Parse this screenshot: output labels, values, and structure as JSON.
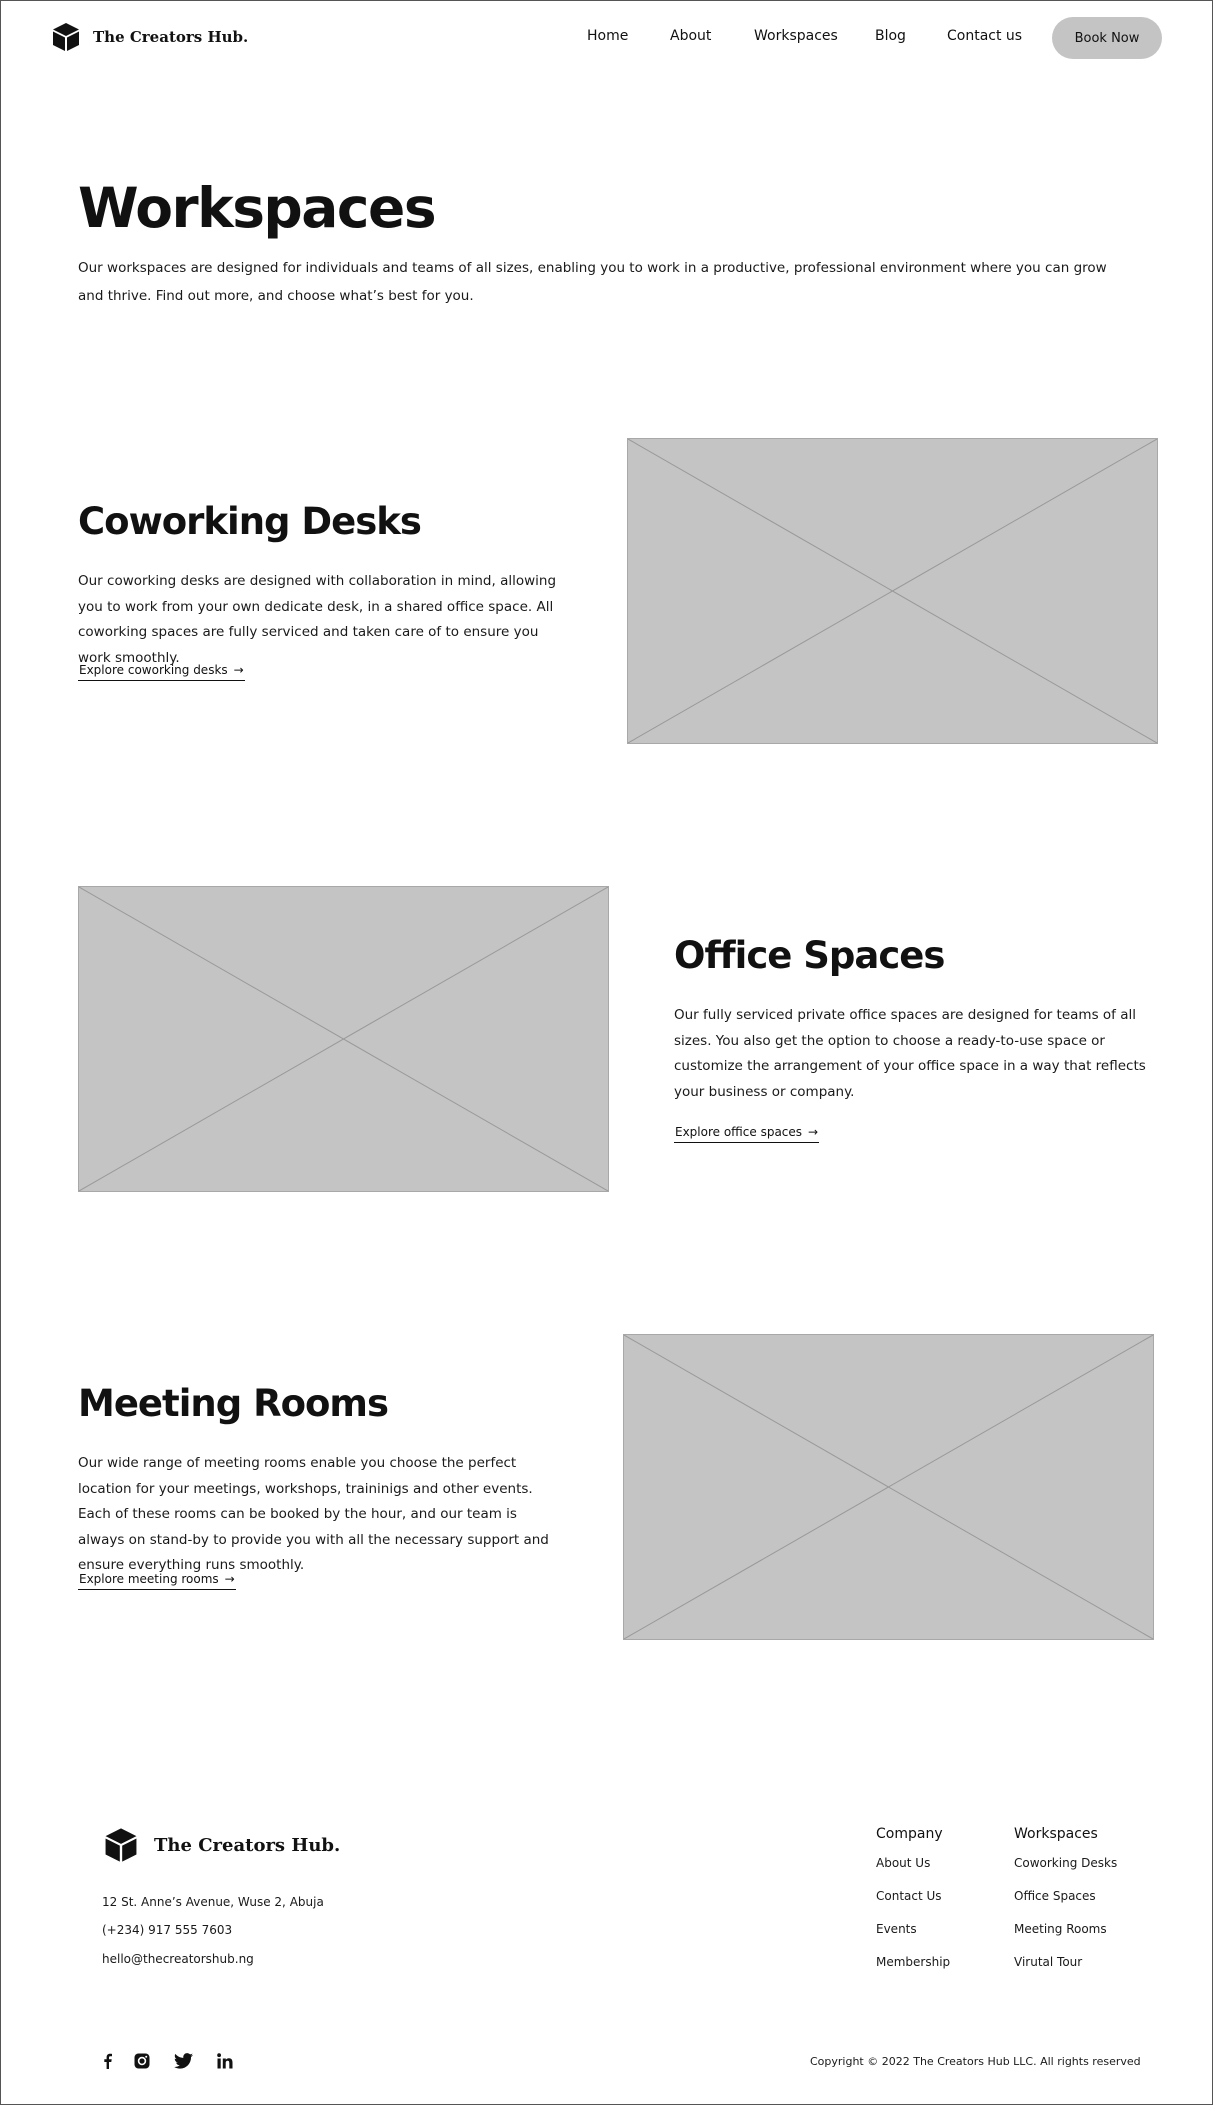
{
  "header": {
    "brand": "The Creators Hub.",
    "nav": [
      "Home",
      "About",
      "Workspaces",
      "Blog",
      "Contact us"
    ],
    "cta": "Book Now"
  },
  "hero": {
    "title": "Workspaces",
    "intro": "Our workspaces are designed for individuals and teams of all sizes, enabling you to work in a productive, professional environment where you can grow and thrive. Find out more, and choose what’s best for you."
  },
  "sections": [
    {
      "title": "Coworking Desks",
      "body": "Our coworking desks are designed with collaboration in mind, allowing you to work from your own dedicate desk, in a shared office space. All coworking spaces are fully serviced and taken care of to ensure you work smoothly.",
      "link": "Explore coworking desks"
    },
    {
      "title": "Office Spaces",
      "body": "Our fully serviced private office spaces are designed for teams of all sizes. You also get the option to choose a ready-to-use space or customize the arrangement of your office space in a way that reflects your business or company.",
      "link": "Explore office spaces"
    },
    {
      "title": "Meeting Rooms",
      "body": "Our wide range of meeting rooms enable you choose the perfect location for your meetings, workshops, traininigs and other events. Each of these rooms can be booked by the hour, and our team is always on stand-by to provide you with all the necessary support and ensure everything runs smoothly.",
      "link": "Explore meeting rooms"
    }
  ],
  "footer": {
    "brand": "The Creators Hub.",
    "address": "12 St. Anne’s Avenue, Wuse 2, Abuja",
    "phone": "(+234) 917 555 7603",
    "email": "hello@thecreatorshub.ng",
    "columns": [
      {
        "heading": "Company",
        "links": [
          "About Us",
          "Contact Us",
          "Events",
          "Membership"
        ]
      },
      {
        "heading": "Workspaces",
        "links": [
          "Coworking Desks",
          "Office Spaces",
          "Meeting Rooms",
          "Virutal Tour"
        ]
      }
    ],
    "social_icons": [
      "facebook-icon",
      "instagram-icon",
      "twitter-icon",
      "linkedin-icon"
    ],
    "copyright": "Copyright © 2022 The Creators Hub LLC. All rights reserved"
  },
  "colors": {
    "placeholder": "#c4c4c4",
    "button": "#c4c4c4",
    "text": "#111111"
  }
}
